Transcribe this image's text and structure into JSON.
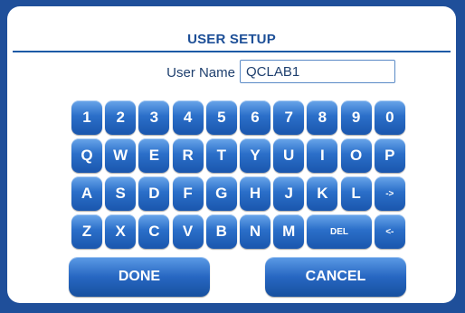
{
  "dialog": {
    "title": "USER SETUP",
    "field_label": "User Name",
    "field_value": "QCLAB1"
  },
  "keyboard": {
    "row1": [
      "1",
      "2",
      "3",
      "4",
      "5",
      "6",
      "7",
      "8",
      "9",
      "0"
    ],
    "row2": [
      "Q",
      "W",
      "E",
      "R",
      "T",
      "Y",
      "U",
      "I",
      "O",
      "P"
    ],
    "row3": [
      "A",
      "S",
      "D",
      "F",
      "G",
      "H",
      "J",
      "K",
      "L",
      "->"
    ],
    "row4": [
      "Z",
      "X",
      "C",
      "V",
      "B",
      "N",
      "M",
      "DEL",
      "<-"
    ]
  },
  "actions": {
    "done_label": "DONE",
    "cancel_label": "CANCEL"
  },
  "colors": {
    "frame": "#1f4f9a",
    "key_top": "#6aa6ea",
    "key_bottom": "#1a56ad",
    "title": "#1d4f97"
  }
}
